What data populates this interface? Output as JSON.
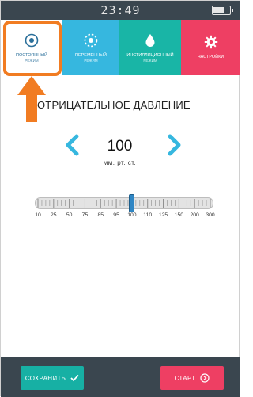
{
  "status_bar": {
    "time": "23:49"
  },
  "tabs": [
    {
      "label": "ПОСТОЯННЫЙ",
      "sub": "РЕЖИМ"
    },
    {
      "label": "ПЕРЕМЕННЫЙ",
      "sub": "РЕЖИМ"
    },
    {
      "label": "ИНСТИЛЛЯЦИОННЫЙ",
      "sub": "РЕЖИМ"
    },
    {
      "label": "НАСТРОЙКИ",
      "sub": ""
    }
  ],
  "main": {
    "title": "ОТРИЦАТЕЛЬНОЕ ДАВЛЕНИЕ",
    "value": "100",
    "unit": "мм. рт. ст."
  },
  "slider": {
    "ticks": [
      "10",
      "25",
      "50",
      "75",
      "85",
      "95",
      "100",
      "110",
      "125",
      "150",
      "200",
      "300"
    ],
    "selected": "100"
  },
  "buttons": {
    "save": "СОХРАНИТЬ",
    "start": "СТАРТ"
  },
  "colors": {
    "header": "#3a464f",
    "tab_blue": "#36b7df",
    "tab_teal": "#19b5a6",
    "tab_pink": "#ee3f63",
    "highlight": "#f17c22",
    "accent": "#2f86c4"
  }
}
